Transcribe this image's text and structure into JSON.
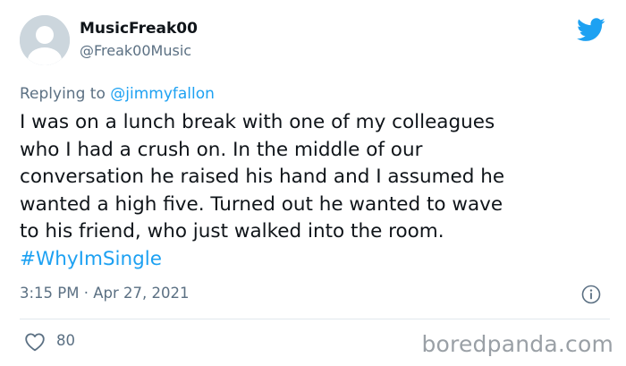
{
  "user": {
    "display_name": "MusicFreak00",
    "handle": "@Freak00Music"
  },
  "reply": {
    "prefix": "Replying to ",
    "mention": "@jimmyfallon"
  },
  "tweet": {
    "lines": [
      "I was on a lunch break with one of my colleagues",
      "who I had a crush on. In the middle of our",
      "conversation he raised his hand and I assumed he",
      "wanted a high five. Turned out he wanted to wave",
      "to his friend, who just walked into the room."
    ],
    "hashtag": "#WhyImSingle"
  },
  "meta": {
    "timestamp": "3:15 PM · Apr 27, 2021"
  },
  "actions": {
    "likes": "80"
  },
  "watermark": "boredpanda.com",
  "colors": {
    "accent": "#1da1f2",
    "secondary_text": "#5b7083",
    "primary_text": "#0f1419",
    "avatar_bg": "#ccd6dd"
  },
  "icons": {
    "brand": "twitter-bird-icon",
    "info": "info-icon",
    "like": "heart-icon"
  }
}
